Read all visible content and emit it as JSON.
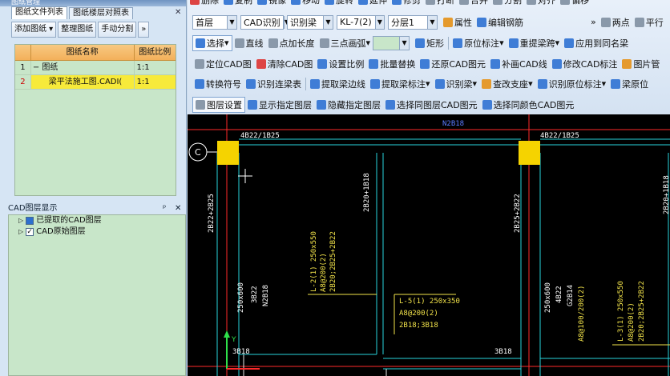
{
  "left_panel": {
    "window_title": "图纸管理",
    "tabs": [
      "图纸文件列表",
      "图纸楼层对照表"
    ],
    "buttons": [
      "添加图纸",
      "整理图纸",
      "手动分割"
    ],
    "grid": {
      "headers": [
        "图纸名称",
        "图纸比例"
      ],
      "rows": [
        {
          "index": "1",
          "toggle": "−",
          "name": "图纸",
          "ratio": "1:1"
        },
        {
          "index": "2",
          "toggle": "",
          "name": "梁平法施工图.CADI(",
          "ratio": "1:1"
        }
      ]
    },
    "layers_title": "CAD图层显示",
    "layers": [
      "已提取的CAD图层",
      "CAD原始图层"
    ]
  },
  "toolbar": {
    "row0": [
      "删除",
      "复制",
      "镜像",
      "移动",
      "旋转",
      "延伸",
      "修剪",
      "打断",
      "合并",
      "分割",
      "对齐",
      "偏移"
    ],
    "row1": {
      "floor": "首层",
      "mode": "CAD识别",
      "recognize": "识别梁",
      "member": "KL-7(2)",
      "layer": "分层1",
      "items": [
        "属性",
        "编辑钢筋",
        "两点",
        "平行"
      ]
    },
    "row2": [
      "选择",
      "直线",
      "点加长度",
      "三点画弧",
      "矩形",
      "原位标注",
      "重提梁跨",
      "应用到同名梁"
    ],
    "row3": [
      "定位CAD图",
      "清除CAD图",
      "设置比例",
      "批量替换",
      "还原CAD图元",
      "补画CAD线",
      "修改CAD标注",
      "图片管"
    ],
    "row4": [
      "转换符号",
      "识别连梁表",
      "提取梁边线",
      "提取梁标注",
      "识别梁",
      "查改支座",
      "识别原位标注",
      "梁原位"
    ],
    "row5": [
      "图层设置",
      "显示指定图层",
      "隐藏指定图层",
      "选择同图层CAD图元",
      "选择同颜色CAD图元"
    ]
  },
  "cad": {
    "axis_label": "C",
    "texts": [
      "4B22/1B25",
      "N2B18",
      "4B22/1B25",
      "2B22+2B25",
      "2B20+1B18",
      "2B25+2B22",
      "2B20+1B18",
      "L-2(1) 250x550",
      "A8@200(2)",
      "2B20;2B25+2B22",
      "250x600",
      "3B22",
      "N2B18",
      "L-5(1) 250x350",
      "A8@200(2)",
      "2B18;3B18",
      "250x600",
      "4B22",
      "G2B14",
      "A8@100/200(2)",
      "L-3(1) 250x550",
      "A8@200(2)",
      "2B20;2B25+2B22",
      "3B18",
      "3B18"
    ],
    "colors": {
      "background": "#000000",
      "column": "#f5d300",
      "beam_edge": "#29d3dd",
      "annotation": "#f2e34a",
      "text_white": "#ffffff",
      "axis": "#ff2a2a"
    }
  }
}
